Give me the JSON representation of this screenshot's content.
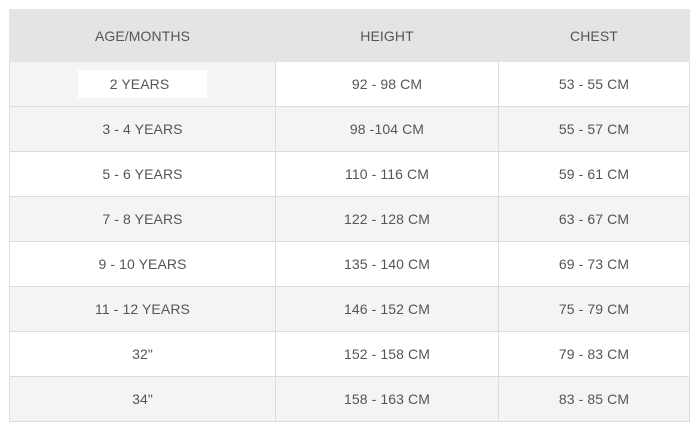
{
  "table": {
    "headers": [
      "AGE/MONTHS",
      "HEIGHT",
      "CHEST"
    ],
    "rows": [
      [
        "2 YEARS",
        "92 - 98 CM",
        "53 - 55 CM"
      ],
      [
        "3 - 4 YEARS",
        "98 -104 CM",
        "55 - 57 CM"
      ],
      [
        "5 - 6 YEARS",
        "110 - 116 CM",
        "59 - 61 CM"
      ],
      [
        "7 - 8 YEARS",
        "122 - 128 CM",
        "63 - 67 CM"
      ],
      [
        "9 - 10 YEARS",
        "135 - 140 CM",
        "69 - 73 CM"
      ],
      [
        "11 - 12 YEARS",
        "146 - 152 CM",
        "75 - 79 CM"
      ],
      [
        "32\"",
        "152 - 158 CM",
        "79 - 83 CM"
      ],
      [
        "34\"",
        "158 - 163 CM",
        "83 - 85 CM"
      ]
    ]
  },
  "colors": {
    "header_bg": "#e4e4e4",
    "row_alt_bg": "#f4f4f4",
    "border": "#dcdcdc",
    "text": "#555555"
  }
}
